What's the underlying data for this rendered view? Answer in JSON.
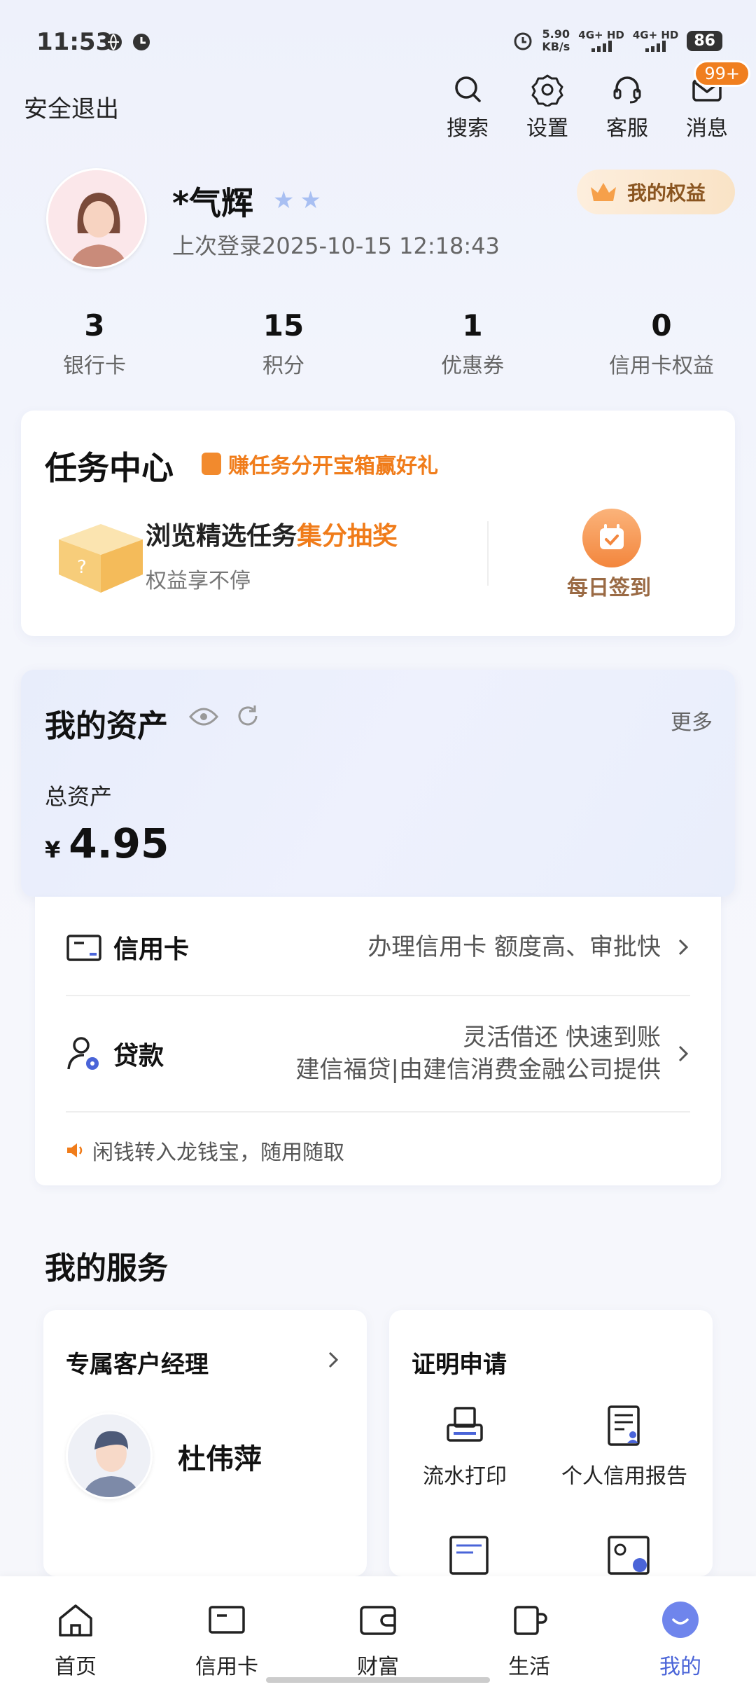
{
  "status_bar": {
    "time": "11:53",
    "net_speed": "5.90",
    "net_unit": "KB/s",
    "sim1": "4G+ HD",
    "sim2": "4G+ HD",
    "battery": "86"
  },
  "header": {
    "logout_label": "安全退出",
    "actions": [
      {
        "label": "搜索",
        "icon": "search-icon"
      },
      {
        "label": "设置",
        "icon": "settings-icon"
      },
      {
        "label": "客服",
        "icon": "headset-icon"
      },
      {
        "label": "消息",
        "icon": "mail-icon",
        "badge": "99+"
      }
    ]
  },
  "profile": {
    "name": "*气辉",
    "last_login": "上次登录2025-10-15 12:18:43",
    "rights_label": "我的权益",
    "stats": [
      {
        "value": "3",
        "label": "银行卡"
      },
      {
        "value": "15",
        "label": "积分"
      },
      {
        "value": "1",
        "label": "优惠券"
      },
      {
        "value": "0",
        "label": "信用卡权益"
      }
    ]
  },
  "task_center": {
    "title": "任务中心",
    "tag": "赚任务分开宝箱赢好礼",
    "main_text": "浏览精选任务",
    "main_highlight": "集分抽奖",
    "sub_text": "权益享不停",
    "checkin_label": "每日签到"
  },
  "assets": {
    "title": "我的资产",
    "more_label": "更多",
    "total_label": "总资产",
    "currency": "¥",
    "total_value": "4.95",
    "rows": [
      {
        "title": "信用卡",
        "desc": "办理信用卡 额度高、审批快"
      },
      {
        "title": "贷款",
        "desc_line1": "灵活借还 快速到账",
        "desc_line2": "建信福贷|由建信消费金融公司提供"
      }
    ],
    "tip": "闲钱转入龙钱宝，随用随取"
  },
  "services": {
    "title": "我的服务",
    "manager": {
      "title": "专属客户经理",
      "name": "杜伟萍"
    },
    "certificates": {
      "title": "证明申请",
      "items": [
        {
          "label": "流水打印",
          "icon": "printer-icon"
        },
        {
          "label": "个人信用报告",
          "icon": "credit-report-icon"
        }
      ]
    }
  },
  "bottom_nav": [
    {
      "label": "首页",
      "icon": "home-icon"
    },
    {
      "label": "信用卡",
      "icon": "card-icon"
    },
    {
      "label": "财富",
      "icon": "wallet-icon"
    },
    {
      "label": "生活",
      "icon": "cup-icon"
    },
    {
      "label": "我的",
      "icon": "profile-icon",
      "active": true
    }
  ],
  "colors": {
    "accent_orange": "#f07c1a",
    "accent_blue": "#4a64d8"
  }
}
